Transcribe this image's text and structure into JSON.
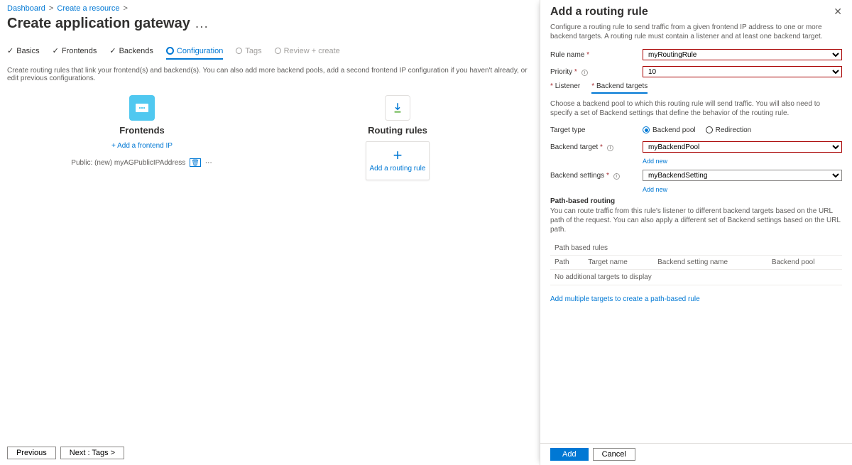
{
  "breadcrumb": {
    "items": [
      "Dashboard",
      "Create a resource"
    ]
  },
  "page_title": "Create application gateway",
  "tabs": {
    "basics": "Basics",
    "frontends": "Frontends",
    "backends": "Backends",
    "configuration": "Configuration",
    "tags": "Tags",
    "review": "Review + create"
  },
  "config_subtext": "Create routing rules that link your frontend(s) and backend(s). You can also add more backend pools, add a second frontend IP configuration if you haven't already, or edit previous configurations.",
  "frontends": {
    "title": "Frontends",
    "add_link": "+ Add a frontend IP",
    "item_label": "Public: (new) myAGPublicIPAddress"
  },
  "routing": {
    "title": "Routing rules",
    "add_card": "Add a routing rule"
  },
  "footer": {
    "prev": "Previous",
    "next": "Next : Tags >"
  },
  "panel": {
    "title": "Add a routing rule",
    "desc": "Configure a routing rule to send traffic from a given frontend IP address to one or more backend targets. A routing rule must contain a listener and at least one backend target.",
    "rule_name_label": "Rule name",
    "rule_name_value": "myRoutingRule",
    "priority_label": "Priority",
    "priority_value": "10",
    "sub_listener": "Listener",
    "sub_backend": "Backend targets",
    "backend_hint": "Choose a backend pool to which this routing rule will send traffic. You will also need to specify a set of Backend settings that define the behavior of the routing rule.",
    "target_type_label": "Target type",
    "target_type_pool": "Backend pool",
    "target_type_redirect": "Redirection",
    "backend_target_label": "Backend target",
    "backend_target_value": "myBackendPool",
    "backend_settings_label": "Backend settings",
    "backend_settings_value": "myBackendSetting",
    "add_new": "Add new",
    "path_section_title": "Path-based routing",
    "path_hint": "You can route traffic from this rule's listener to different backend targets based on the URL path of the request. You can also apply a different set of Backend settings based on the URL path.",
    "tbl": {
      "h0": "Path based rules",
      "h1": "Path",
      "h2": "Target name",
      "h3": "Backend setting name",
      "h4": "Backend pool",
      "empty": "No additional targets to display"
    },
    "add_multi": "Add multiple targets to create a path-based rule",
    "btn_add": "Add",
    "btn_cancel": "Cancel"
  }
}
